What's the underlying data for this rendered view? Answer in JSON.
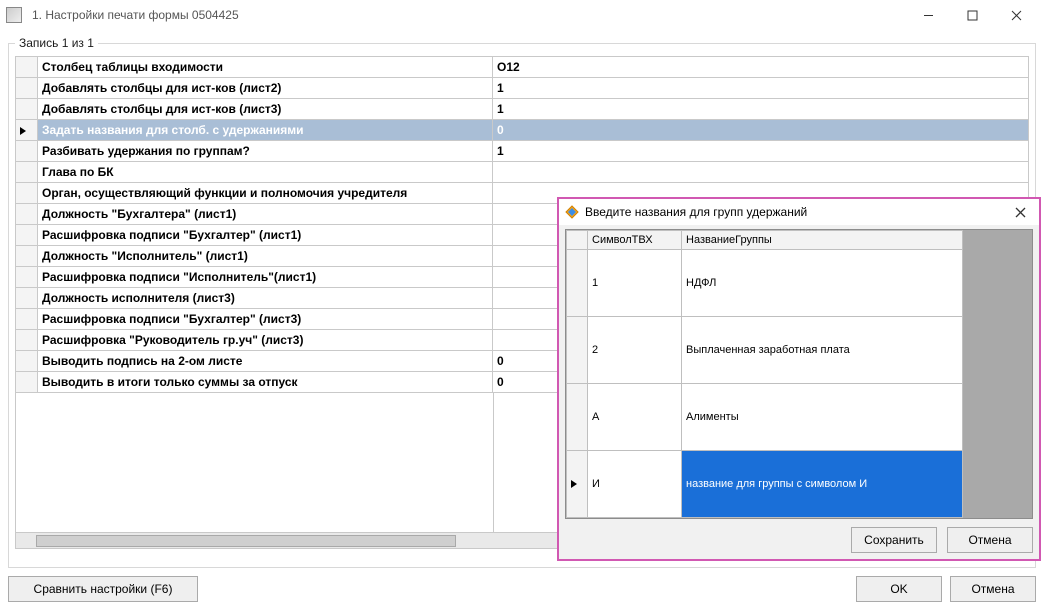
{
  "window": {
    "title": "1. Настройки печати формы 0504425"
  },
  "group": {
    "legend": "Запись 1 из 1"
  },
  "settings": [
    {
      "label": "Столбец таблицы входимости",
      "value": "O12"
    },
    {
      "label": "Добавлять столбцы для ист-ков (лист2)",
      "value": "1"
    },
    {
      "label": "Добавлять столбцы для ист-ков (лист3)",
      "value": "1"
    },
    {
      "label": "Задать названия для столб. с удержаниями",
      "value": "0",
      "selected": true
    },
    {
      "label": "Разбивать удержания по группам?",
      "value": "1"
    },
    {
      "label": "Глава по БК",
      "value": ""
    },
    {
      "label": "Орган, осуществляющий функции и полномочия учредителя",
      "value": ""
    },
    {
      "label": "Должность \"Бухгалтера\" (лист1)",
      "value": ""
    },
    {
      "label": "Расшифровка подписи \"Бухгалтер\" (лист1)",
      "value": ""
    },
    {
      "label": "Должность \"Исполнитель\" (лист1)",
      "value": ""
    },
    {
      "label": "Расшифровка подписи \"Исполнитель\"(лист1)",
      "value": ""
    },
    {
      "label": "Должность исполнителя (лист3)",
      "value": ""
    },
    {
      "label": "Расшифровка подписи \"Бухгалтер\" (лист3)",
      "value": ""
    },
    {
      "label": "Расшифровка \"Руководитель гр.уч\" (лист3)",
      "value": ""
    },
    {
      "label": "Выводить подпись на 2-ом листе",
      "value": "0"
    },
    {
      "label": "Выводить в итоги только суммы за отпуск",
      "value": "0"
    }
  ],
  "mainButtons": {
    "compare": "Сравнить настройки (F6)",
    "ok": "OK",
    "cancel": "Отмена"
  },
  "dialog": {
    "title": "Введите названия для групп удержаний",
    "columns": {
      "c1": "СимволТВХ",
      "c2": "НазваниеГруппы"
    },
    "rows": [
      {
        "sym": "1",
        "name": "НДФЛ"
      },
      {
        "sym": "2",
        "name": "Выплаченная заработная плата"
      },
      {
        "sym": "А",
        "name": "Алименты"
      },
      {
        "sym": "И",
        "name": "название для группы с символом И",
        "editing": true
      }
    ],
    "buttons": {
      "save": "Сохранить",
      "cancel": "Отмена"
    }
  }
}
